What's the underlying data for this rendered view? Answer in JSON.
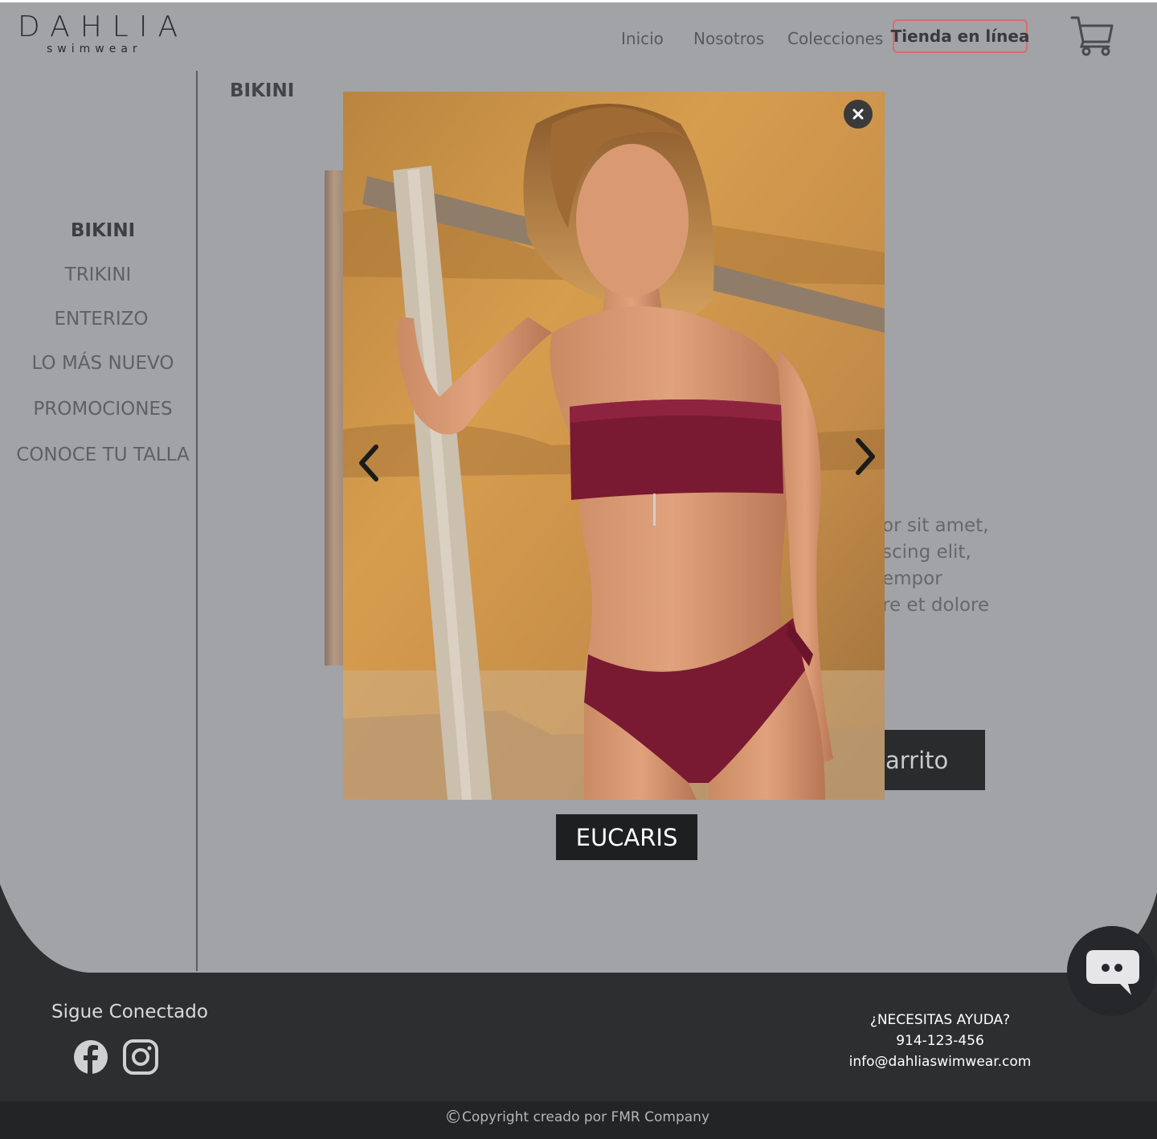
{
  "header": {
    "logo_main": "DAHLIA",
    "logo_sub": "swimwear",
    "nav": [
      "Inicio",
      "Nosotros",
      "Colecciones"
    ],
    "nav_shop": "Tienda en línea",
    "cart_icon": "cart-icon"
  },
  "section_title": "BIKINI",
  "sidebar": {
    "items": [
      {
        "label": "BIKINI",
        "active": true
      },
      {
        "label": "TRIKINI"
      },
      {
        "label": "ENTERIZO"
      },
      {
        "label": "LO MÁS NUEVO"
      },
      {
        "label": "PROMOCIONES"
      },
      {
        "label": "CONOCE TU TALLA"
      }
    ]
  },
  "product": {
    "description_lines": [
      "or sit amet,",
      "scing elit,",
      "empor",
      "re et dolore"
    ],
    "cart_button": "arrito"
  },
  "lightbox": {
    "caption": "EUCARIS",
    "close_icon": "close-icon",
    "prev_icon": "chevron-left-icon",
    "next_icon": "chevron-right-icon"
  },
  "footer": {
    "follow": "Sigue Conectado",
    "social": [
      "facebook-icon",
      "instagram-icon"
    ],
    "help_title": "¿NECESITAS AYUDA?",
    "phone": "914-123-456",
    "email": "info@dahliaswimwear.com",
    "copyright": "Copyright creado por FMR Company"
  },
  "colors": {
    "overlay_bg": "#a2a3a6",
    "footer_bg": "#2d2e30",
    "accent": "#d96c6c",
    "swimsuit": "#7a1932"
  }
}
